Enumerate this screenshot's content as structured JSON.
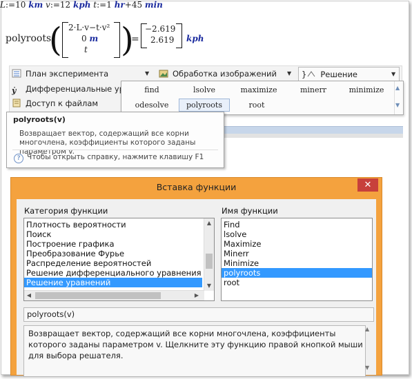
{
  "math": {
    "L_var": "L",
    "L_val": "10",
    "L_unit": "km",
    "v_var": "v",
    "v_val": "12",
    "v_unit": "kph",
    "t_var": "t",
    "t_val1": "1",
    "t_unit1": "hr",
    "t_val2": "45",
    "t_unit2": "min",
    "assign": ":=",
    "poly_fn": "polyroots",
    "cell1": "2·L·v−t·v²",
    "cell2_num": "0",
    "cell2_unit": "m",
    "cell3": "t",
    "equals": "=",
    "res1": "−2.619",
    "res2": "2.619",
    "res_unit": "kph"
  },
  "toolbar": {
    "plan": "План эксперимента",
    "image": "Обработка изображений",
    "solve": "Решение",
    "diff": "Дифференциальные уравнения",
    "files": "Доступ к файлам"
  },
  "palette": {
    "row1": [
      "find",
      "lsolve",
      "maximize",
      "minerr",
      "minimize"
    ],
    "row2": [
      "odesolve",
      "polyroots",
      "root"
    ],
    "selected": "polyroots"
  },
  "tooltip": {
    "title": "polyroots(v)",
    "desc": "Возвращает вектор, содержащий все корни многочлена, коэффициенты которого заданы параметром v.",
    "help": "Чтобы открыть справку, нажмите клавишу F1"
  },
  "dialog": {
    "title": "Вставка функции",
    "close": "✕",
    "category_label": "Категория функции",
    "name_label": "Имя функции",
    "categories": [
      "Плотность вероятности",
      "Поиск",
      "Построение графика",
      "Преобразование Фурье",
      "Распределение вероятностей",
      "Решение дифференциального уравнения",
      "Решение уравнений"
    ],
    "selected_category": "Решение уравнений",
    "functions": [
      "Find",
      "lsolve",
      "Maximize",
      "Minerr",
      "Minimize",
      "polyroots",
      "root"
    ],
    "selected_function": "polyroots",
    "signature": "polyroots(v)",
    "description": "Возвращает вектор, содержащий все корни многочлена, коэффициенты которого заданы параметром v. Щелкните эту функцию правой кнопкой мыши для выбора решателя."
  },
  "colors": {
    "unit": "#1a2a9e",
    "dialog_frame": "#f4a23e",
    "selection": "#3399ff",
    "close_button": "#c7403b"
  }
}
